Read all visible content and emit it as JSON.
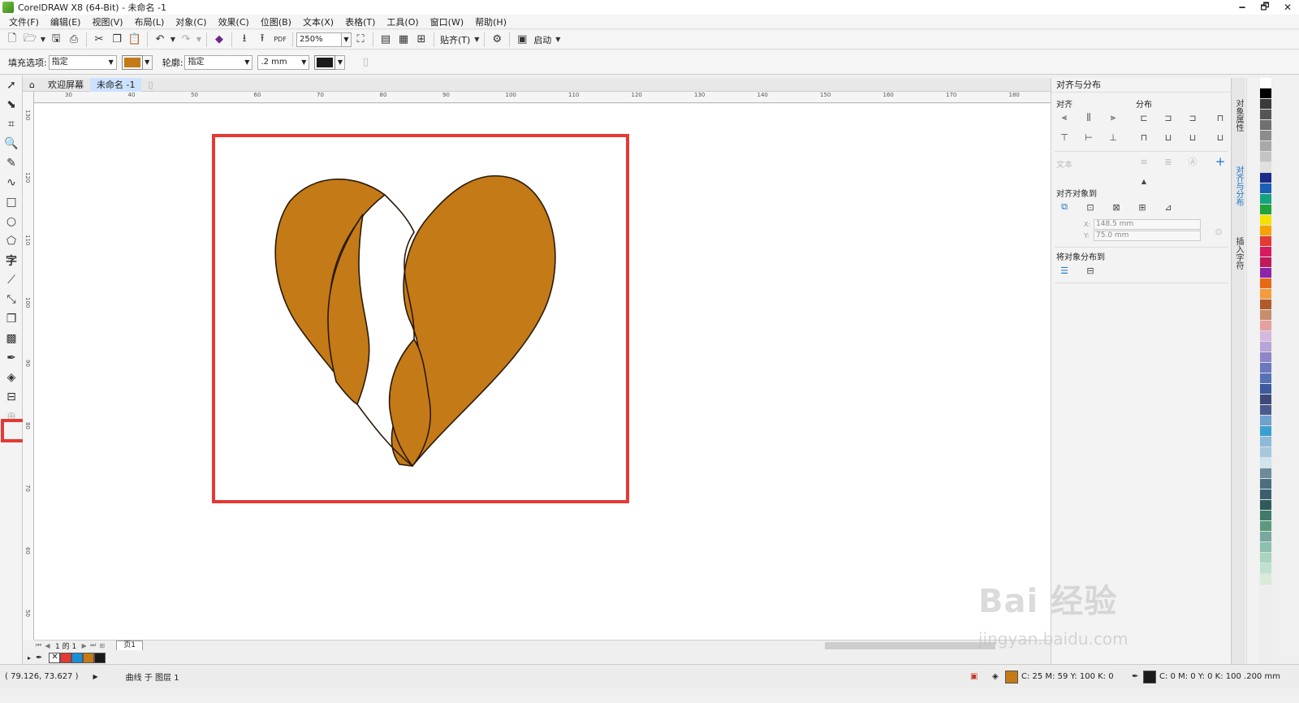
{
  "window": {
    "title": "CorelDRAW X8 (64-Bit) - 未命名 -1",
    "controls": [
      "🗕",
      "🗗",
      "✕"
    ]
  },
  "menu": [
    "文件(F)",
    "编辑(E)",
    "视图(V)",
    "布局(L)",
    "对象(C)",
    "效果(C)",
    "位图(B)",
    "文本(X)",
    "表格(T)",
    "工具(O)",
    "窗口(W)",
    "帮助(H)"
  ],
  "toolbar": {
    "zoom": "250%",
    "snap_label": "贴齐(T)",
    "launch_label": "启动"
  },
  "propbar": {
    "fill_label": "填充选项:",
    "fill_value": "指定",
    "fill_color": "#c47a16",
    "outline_label": "轮廓:",
    "outline_value": "指定",
    "outline_width": ".2 mm",
    "outline_color": "#1a1a1a"
  },
  "tabs": {
    "welcome": "欢迎屏幕",
    "doc": "未命名 -1"
  },
  "ruler": {
    "h_ticks": [
      "30",
      "40",
      "50",
      "60",
      "70",
      "80",
      "90",
      "100",
      "110",
      "120",
      "130",
      "140",
      "150",
      "160",
      "170",
      "180"
    ],
    "v_ticks": [
      "130",
      "120",
      "110",
      "100",
      "90",
      "80",
      "70",
      "60",
      "50"
    ]
  },
  "drawing": {
    "fill_color": "#c47a16",
    "stroke_color": "#2a1a0a"
  },
  "pagenav": {
    "page_count": "1 的 1",
    "page_tab": "页1"
  },
  "docker": {
    "title": "对齐与分布",
    "align_label": "对齐",
    "distribute_label": "分布",
    "text_label": "文本",
    "align_to_label": "对齐对象到",
    "x_value": "148.5 mm",
    "y_value": "75.0 mm",
    "distribute_to_label": "将对象分布到",
    "vertical_tabs": [
      "对象属性",
      "对齐与分布",
      "插入字符"
    ]
  },
  "status": {
    "coords": "( 79.126, 73.627 )",
    "object_info": "曲线 于 图层 1",
    "fill_info": "C: 25 M: 59 Y: 100 K: 0",
    "outline_info": "C: 0 M: 0 Y: 0 K: 100 .200 mm"
  },
  "palette": [
    "#ffffff",
    "#000000",
    "#3a3a3a",
    "#555555",
    "#707070",
    "#8c8c8c",
    "#a8a8a8",
    "#c4c4c4",
    "#e0e0e0",
    "#1c2a8c",
    "#1a5fb4",
    "#14a37f",
    "#1fa33a",
    "#f5e100",
    "#f5a300",
    "#e53935",
    "#d81b60",
    "#c2185b",
    "#8e24aa",
    "#e86a17",
    "#f39c3b",
    "#b25a2a",
    "#c78e6b",
    "#e7a0a0",
    "#d5b8e0",
    "#b8a4d6",
    "#8f86c7",
    "#6b77c0",
    "#5572b8",
    "#3c5a9e",
    "#3d4a78",
    "#4b5a8c",
    "#6fa0d0",
    "#3aa0d0",
    "#8bbbd8",
    "#a6c8dc",
    "#d0e4ee",
    "#6a8c9a",
    "#4a7080",
    "#3a6070",
    "#2e5a5a",
    "#3f7a6a",
    "#5a9a80",
    "#7aa8a0",
    "#8cc0b0",
    "#a8d4c0",
    "#c0e0d0",
    "#d8ecd8"
  ],
  "doc_palette": [
    "#ffffff",
    "#e53935",
    "#1a8fd8",
    "#c47a16",
    "#1a1a1a"
  ],
  "watermark": {
    "text": "Bai 经验",
    "url": "jingyan.baidu.com"
  }
}
